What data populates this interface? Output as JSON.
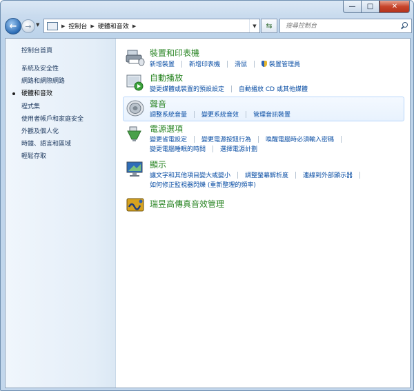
{
  "breadcrumb": [
    "控制台",
    "硬體和音效"
  ],
  "search": {
    "placeholder": "搜尋控制台"
  },
  "sidebar": {
    "home": "控制台首頁",
    "items": [
      "系統及安全性",
      "網路和網際網路",
      "硬體和音效",
      "程式集",
      "使用者帳戶和家庭安全",
      "外觀及個人化",
      "時鐘、語言和區域",
      "輕鬆存取"
    ],
    "current_index": 2
  },
  "categories": [
    {
      "title": "裝置和印表機",
      "icon": "printer-icon",
      "rows": [
        [
          "新增裝置",
          "新增印表機",
          "滑鼠",
          "裝置管理員"
        ]
      ]
    },
    {
      "title": "自動播放",
      "icon": "autoplay-icon",
      "rows": [
        [
          "變更媒體或裝置的預設設定",
          "自動播放 CD 或其他媒體"
        ]
      ]
    },
    {
      "title": "聲音",
      "icon": "speaker-icon",
      "rows": [
        [
          "調整系統音量",
          "變更系統音效",
          "管理音訊裝置"
        ]
      ]
    },
    {
      "title": "電源選項",
      "icon": "power-options-icon",
      "rows": [
        [
          "變更省電設定",
          "變更電源按鈕行為",
          "喚醒電腦時必須輸入密碼"
        ],
        [
          "變更電腦睡眠的時間",
          "選擇電源計劃"
        ]
      ]
    },
    {
      "title": "顯示",
      "icon": "display-icon",
      "rows": [
        [
          "讓文字和其他項目變大或變小",
          "調整螢幕解析度",
          "連線到外部顯示器"
        ],
        [
          "如何修正監視器閃爍 (重新整理的頻率)"
        ]
      ]
    },
    {
      "title": "瑞昱高傳真音效管理",
      "icon": "realtek-audio-icon",
      "rows": []
    }
  ],
  "colors": {
    "link": "#0a4ea4",
    "category_title": "#2a8524",
    "accent": "#2b6bb4"
  }
}
